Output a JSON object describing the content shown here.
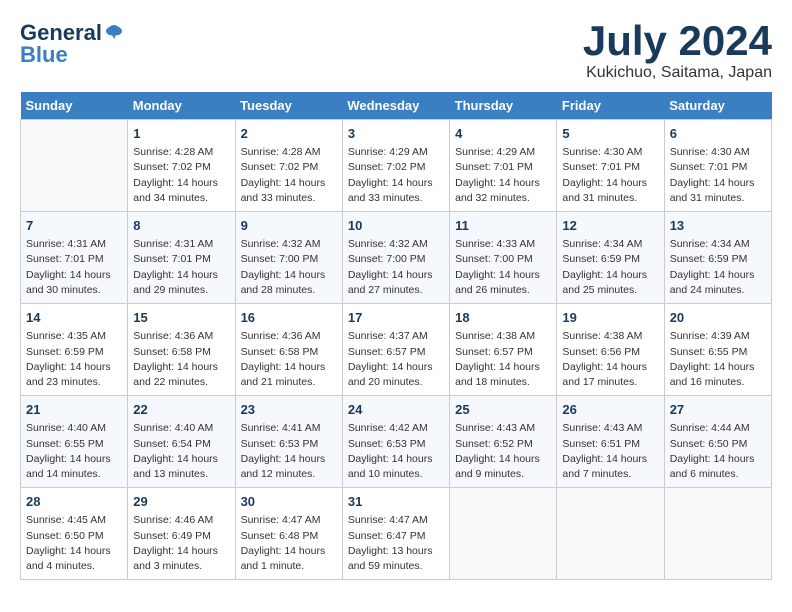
{
  "header": {
    "logo_line1": "General",
    "logo_line2": "Blue",
    "month_year": "July 2024",
    "location": "Kukichuo, Saitama, Japan"
  },
  "days_of_week": [
    "Sunday",
    "Monday",
    "Tuesday",
    "Wednesday",
    "Thursday",
    "Friday",
    "Saturday"
  ],
  "weeks": [
    [
      {
        "day": "",
        "detail": ""
      },
      {
        "day": "1",
        "detail": "Sunrise: 4:28 AM\nSunset: 7:02 PM\nDaylight: 14 hours\nand 34 minutes."
      },
      {
        "day": "2",
        "detail": "Sunrise: 4:28 AM\nSunset: 7:02 PM\nDaylight: 14 hours\nand 33 minutes."
      },
      {
        "day": "3",
        "detail": "Sunrise: 4:29 AM\nSunset: 7:02 PM\nDaylight: 14 hours\nand 33 minutes."
      },
      {
        "day": "4",
        "detail": "Sunrise: 4:29 AM\nSunset: 7:01 PM\nDaylight: 14 hours\nand 32 minutes."
      },
      {
        "day": "5",
        "detail": "Sunrise: 4:30 AM\nSunset: 7:01 PM\nDaylight: 14 hours\nand 31 minutes."
      },
      {
        "day": "6",
        "detail": "Sunrise: 4:30 AM\nSunset: 7:01 PM\nDaylight: 14 hours\nand 31 minutes."
      }
    ],
    [
      {
        "day": "7",
        "detail": "Sunrise: 4:31 AM\nSunset: 7:01 PM\nDaylight: 14 hours\nand 30 minutes."
      },
      {
        "day": "8",
        "detail": "Sunrise: 4:31 AM\nSunset: 7:01 PM\nDaylight: 14 hours\nand 29 minutes."
      },
      {
        "day": "9",
        "detail": "Sunrise: 4:32 AM\nSunset: 7:00 PM\nDaylight: 14 hours\nand 28 minutes."
      },
      {
        "day": "10",
        "detail": "Sunrise: 4:32 AM\nSunset: 7:00 PM\nDaylight: 14 hours\nand 27 minutes."
      },
      {
        "day": "11",
        "detail": "Sunrise: 4:33 AM\nSunset: 7:00 PM\nDaylight: 14 hours\nand 26 minutes."
      },
      {
        "day": "12",
        "detail": "Sunrise: 4:34 AM\nSunset: 6:59 PM\nDaylight: 14 hours\nand 25 minutes."
      },
      {
        "day": "13",
        "detail": "Sunrise: 4:34 AM\nSunset: 6:59 PM\nDaylight: 14 hours\nand 24 minutes."
      }
    ],
    [
      {
        "day": "14",
        "detail": "Sunrise: 4:35 AM\nSunset: 6:59 PM\nDaylight: 14 hours\nand 23 minutes."
      },
      {
        "day": "15",
        "detail": "Sunrise: 4:36 AM\nSunset: 6:58 PM\nDaylight: 14 hours\nand 22 minutes."
      },
      {
        "day": "16",
        "detail": "Sunrise: 4:36 AM\nSunset: 6:58 PM\nDaylight: 14 hours\nand 21 minutes."
      },
      {
        "day": "17",
        "detail": "Sunrise: 4:37 AM\nSunset: 6:57 PM\nDaylight: 14 hours\nand 20 minutes."
      },
      {
        "day": "18",
        "detail": "Sunrise: 4:38 AM\nSunset: 6:57 PM\nDaylight: 14 hours\nand 18 minutes."
      },
      {
        "day": "19",
        "detail": "Sunrise: 4:38 AM\nSunset: 6:56 PM\nDaylight: 14 hours\nand 17 minutes."
      },
      {
        "day": "20",
        "detail": "Sunrise: 4:39 AM\nSunset: 6:55 PM\nDaylight: 14 hours\nand 16 minutes."
      }
    ],
    [
      {
        "day": "21",
        "detail": "Sunrise: 4:40 AM\nSunset: 6:55 PM\nDaylight: 14 hours\nand 14 minutes."
      },
      {
        "day": "22",
        "detail": "Sunrise: 4:40 AM\nSunset: 6:54 PM\nDaylight: 14 hours\nand 13 minutes."
      },
      {
        "day": "23",
        "detail": "Sunrise: 4:41 AM\nSunset: 6:53 PM\nDaylight: 14 hours\nand 12 minutes."
      },
      {
        "day": "24",
        "detail": "Sunrise: 4:42 AM\nSunset: 6:53 PM\nDaylight: 14 hours\nand 10 minutes."
      },
      {
        "day": "25",
        "detail": "Sunrise: 4:43 AM\nSunset: 6:52 PM\nDaylight: 14 hours\nand 9 minutes."
      },
      {
        "day": "26",
        "detail": "Sunrise: 4:43 AM\nSunset: 6:51 PM\nDaylight: 14 hours\nand 7 minutes."
      },
      {
        "day": "27",
        "detail": "Sunrise: 4:44 AM\nSunset: 6:50 PM\nDaylight: 14 hours\nand 6 minutes."
      }
    ],
    [
      {
        "day": "28",
        "detail": "Sunrise: 4:45 AM\nSunset: 6:50 PM\nDaylight: 14 hours\nand 4 minutes."
      },
      {
        "day": "29",
        "detail": "Sunrise: 4:46 AM\nSunset: 6:49 PM\nDaylight: 14 hours\nand 3 minutes."
      },
      {
        "day": "30",
        "detail": "Sunrise: 4:47 AM\nSunset: 6:48 PM\nDaylight: 14 hours\nand 1 minute."
      },
      {
        "day": "31",
        "detail": "Sunrise: 4:47 AM\nSunset: 6:47 PM\nDaylight: 13 hours\nand 59 minutes."
      },
      {
        "day": "",
        "detail": ""
      },
      {
        "day": "",
        "detail": ""
      },
      {
        "day": "",
        "detail": ""
      }
    ]
  ]
}
